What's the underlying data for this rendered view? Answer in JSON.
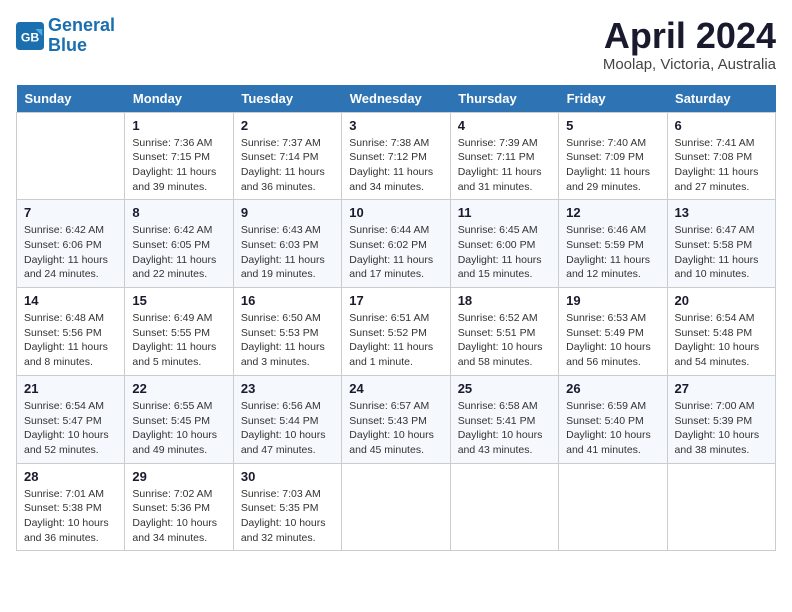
{
  "header": {
    "logo_line1": "General",
    "logo_line2": "Blue",
    "month_title": "April 2024",
    "location": "Moolap, Victoria, Australia"
  },
  "weekdays": [
    "Sunday",
    "Monday",
    "Tuesday",
    "Wednesday",
    "Thursday",
    "Friday",
    "Saturday"
  ],
  "weeks": [
    [
      {
        "day": "",
        "details": ""
      },
      {
        "day": "1",
        "details": "Sunrise: 7:36 AM\nSunset: 7:15 PM\nDaylight: 11 hours\nand 39 minutes."
      },
      {
        "day": "2",
        "details": "Sunrise: 7:37 AM\nSunset: 7:14 PM\nDaylight: 11 hours\nand 36 minutes."
      },
      {
        "day": "3",
        "details": "Sunrise: 7:38 AM\nSunset: 7:12 PM\nDaylight: 11 hours\nand 34 minutes."
      },
      {
        "day": "4",
        "details": "Sunrise: 7:39 AM\nSunset: 7:11 PM\nDaylight: 11 hours\nand 31 minutes."
      },
      {
        "day": "5",
        "details": "Sunrise: 7:40 AM\nSunset: 7:09 PM\nDaylight: 11 hours\nand 29 minutes."
      },
      {
        "day": "6",
        "details": "Sunrise: 7:41 AM\nSunset: 7:08 PM\nDaylight: 11 hours\nand 27 minutes."
      }
    ],
    [
      {
        "day": "7",
        "details": "Sunrise: 6:42 AM\nSunset: 6:06 PM\nDaylight: 11 hours\nand 24 minutes."
      },
      {
        "day": "8",
        "details": "Sunrise: 6:42 AM\nSunset: 6:05 PM\nDaylight: 11 hours\nand 22 minutes."
      },
      {
        "day": "9",
        "details": "Sunrise: 6:43 AM\nSunset: 6:03 PM\nDaylight: 11 hours\nand 19 minutes."
      },
      {
        "day": "10",
        "details": "Sunrise: 6:44 AM\nSunset: 6:02 PM\nDaylight: 11 hours\nand 17 minutes."
      },
      {
        "day": "11",
        "details": "Sunrise: 6:45 AM\nSunset: 6:00 PM\nDaylight: 11 hours\nand 15 minutes."
      },
      {
        "day": "12",
        "details": "Sunrise: 6:46 AM\nSunset: 5:59 PM\nDaylight: 11 hours\nand 12 minutes."
      },
      {
        "day": "13",
        "details": "Sunrise: 6:47 AM\nSunset: 5:58 PM\nDaylight: 11 hours\nand 10 minutes."
      }
    ],
    [
      {
        "day": "14",
        "details": "Sunrise: 6:48 AM\nSunset: 5:56 PM\nDaylight: 11 hours\nand 8 minutes."
      },
      {
        "day": "15",
        "details": "Sunrise: 6:49 AM\nSunset: 5:55 PM\nDaylight: 11 hours\nand 5 minutes."
      },
      {
        "day": "16",
        "details": "Sunrise: 6:50 AM\nSunset: 5:53 PM\nDaylight: 11 hours\nand 3 minutes."
      },
      {
        "day": "17",
        "details": "Sunrise: 6:51 AM\nSunset: 5:52 PM\nDaylight: 11 hours\nand 1 minute."
      },
      {
        "day": "18",
        "details": "Sunrise: 6:52 AM\nSunset: 5:51 PM\nDaylight: 10 hours\nand 58 minutes."
      },
      {
        "day": "19",
        "details": "Sunrise: 6:53 AM\nSunset: 5:49 PM\nDaylight: 10 hours\nand 56 minutes."
      },
      {
        "day": "20",
        "details": "Sunrise: 6:54 AM\nSunset: 5:48 PM\nDaylight: 10 hours\nand 54 minutes."
      }
    ],
    [
      {
        "day": "21",
        "details": "Sunrise: 6:54 AM\nSunset: 5:47 PM\nDaylight: 10 hours\nand 52 minutes."
      },
      {
        "day": "22",
        "details": "Sunrise: 6:55 AM\nSunset: 5:45 PM\nDaylight: 10 hours\nand 49 minutes."
      },
      {
        "day": "23",
        "details": "Sunrise: 6:56 AM\nSunset: 5:44 PM\nDaylight: 10 hours\nand 47 minutes."
      },
      {
        "day": "24",
        "details": "Sunrise: 6:57 AM\nSunset: 5:43 PM\nDaylight: 10 hours\nand 45 minutes."
      },
      {
        "day": "25",
        "details": "Sunrise: 6:58 AM\nSunset: 5:41 PM\nDaylight: 10 hours\nand 43 minutes."
      },
      {
        "day": "26",
        "details": "Sunrise: 6:59 AM\nSunset: 5:40 PM\nDaylight: 10 hours\nand 41 minutes."
      },
      {
        "day": "27",
        "details": "Sunrise: 7:00 AM\nSunset: 5:39 PM\nDaylight: 10 hours\nand 38 minutes."
      }
    ],
    [
      {
        "day": "28",
        "details": "Sunrise: 7:01 AM\nSunset: 5:38 PM\nDaylight: 10 hours\nand 36 minutes."
      },
      {
        "day": "29",
        "details": "Sunrise: 7:02 AM\nSunset: 5:36 PM\nDaylight: 10 hours\nand 34 minutes."
      },
      {
        "day": "30",
        "details": "Sunrise: 7:03 AM\nSunset: 5:35 PM\nDaylight: 10 hours\nand 32 minutes."
      },
      {
        "day": "",
        "details": ""
      },
      {
        "day": "",
        "details": ""
      },
      {
        "day": "",
        "details": ""
      },
      {
        "day": "",
        "details": ""
      }
    ]
  ]
}
